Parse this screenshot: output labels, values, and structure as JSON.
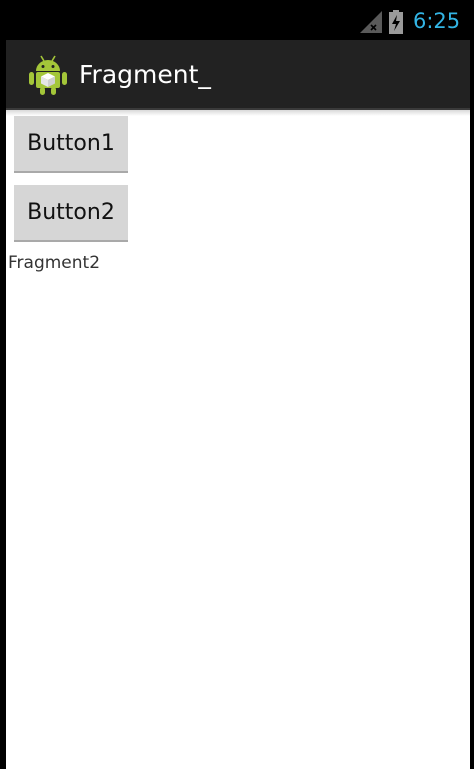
{
  "status_bar": {
    "time": "6:25",
    "signal_icon": "signal-no-service-icon",
    "battery_icon": "battery-charging-icon",
    "accent_color": "#33b5e5"
  },
  "action_bar": {
    "title": "Fragment_",
    "app_icon": "android-app-icon"
  },
  "content": {
    "buttons": [
      {
        "label": "Button1"
      },
      {
        "label": "Button2"
      }
    ],
    "fragment_text": "Fragment2"
  }
}
